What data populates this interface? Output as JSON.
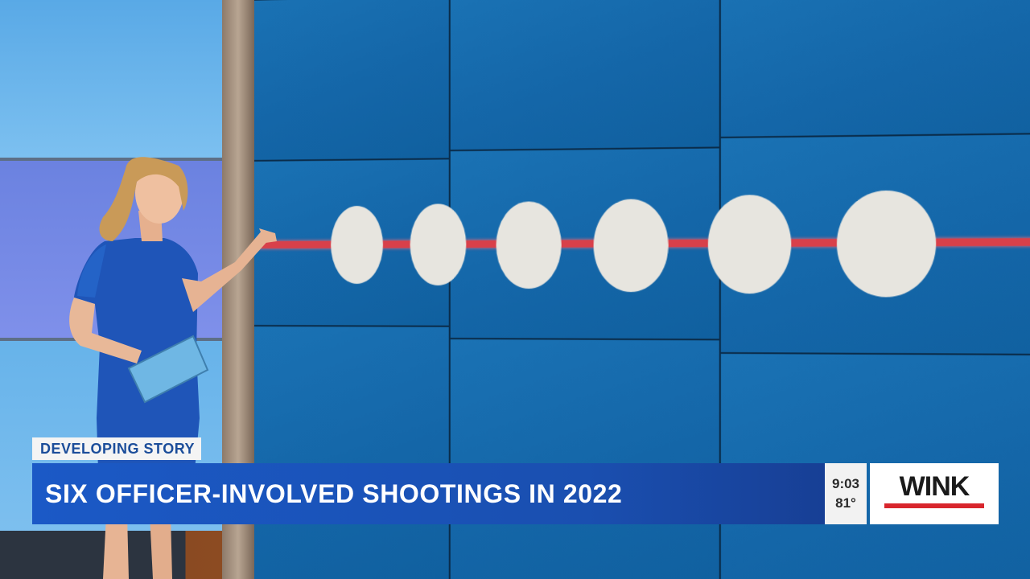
{
  "lower_third": {
    "tag": "DEVELOPING STORY",
    "headline": "SIX OFFICER-INVOLVED SHOOTINGS IN 2022",
    "time": "9:03",
    "temperature": "81°",
    "logo": "WINK"
  },
  "video_wall": {
    "dot_count": 6,
    "strip_color": "#d8404a",
    "dot_color": "#e7e5df"
  },
  "colors": {
    "headline_bar": "#1b59c6",
    "tag_text": "#1b4d9a",
    "logo_rule": "#d8262d"
  }
}
